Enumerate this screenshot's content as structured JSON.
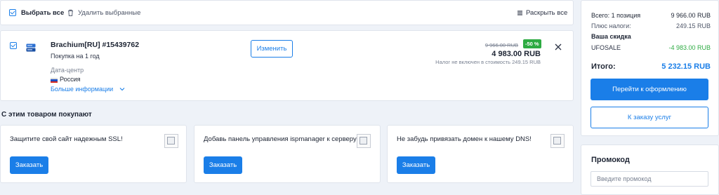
{
  "toolbar": {
    "select_all": "Выбрать все",
    "delete_selected": "Удалить выбранные",
    "expand_all": "Раскрыть все"
  },
  "product": {
    "checked": true,
    "name": "Brachium[RU] #15439762",
    "term": "Покупка на 1 год",
    "datacenter_label": "Дата-центр",
    "country": "Россия",
    "more_info": "Больше информации",
    "change_button": "Изменить",
    "old_price": "9 966.00 RUB",
    "discount": "-50 %",
    "new_price": "4 983.00 RUB",
    "tax_note": "Налог не включен в стоимость 249.15 RUB"
  },
  "upsell": {
    "title": "С этим товаром покупают",
    "items": [
      {
        "text": "Защитите свой сайт надежным SSL!",
        "button": "Заказать"
      },
      {
        "text": "Добавь панель управления ispmanager к серверу!",
        "button": "Заказать"
      },
      {
        "text": "Не забудь привязать домен к нашему DNS!",
        "button": "Заказать"
      }
    ]
  },
  "summary": {
    "total_label": "Всего: 1 позиция",
    "total_value": "9 966.00 RUB",
    "tax_label": "Плюс налоги:",
    "tax_value": "249.15 RUB",
    "discount_title": "Ваша скидка",
    "promo_code": "UFOSALE",
    "promo_value": "-4 983.00 RUB",
    "grand_label": "Итого:",
    "grand_value": "5 232.15 RUB",
    "checkout_button": "Перейти к оформлению",
    "services_button": "К заказу услуг"
  },
  "promo": {
    "title": "Промокод",
    "placeholder": "Введите промокод"
  },
  "colors": {
    "accent": "#1a7ee8",
    "discount_badge": "#2dab42",
    "discount_text": "#2dab42",
    "background": "#eef2f8"
  },
  "icons": {
    "trash": "trash-icon",
    "expand": "expand-icon",
    "server": "server-icon",
    "flag": "russia-flag-icon",
    "close": "close-icon",
    "chevron": "chevron-down-icon"
  }
}
